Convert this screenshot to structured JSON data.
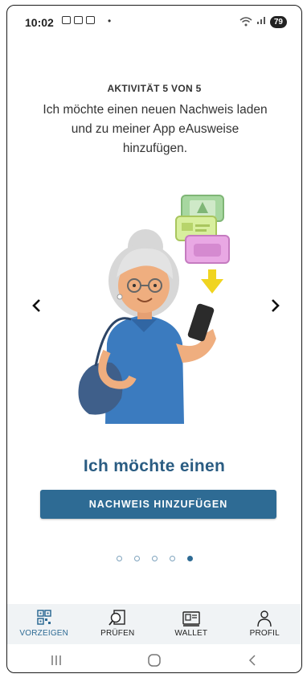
{
  "status_bar": {
    "time": "10:02",
    "separator_dot": "•",
    "battery": "79"
  },
  "onboarding": {
    "activity_label": "AKTIVITÄT 5 VON 5",
    "description": "Ich möchte einen neuen Nachweis laden und zu meiner App eAusweise hinzufügen.",
    "headline": "Ich möchte einen",
    "primary_button": "NACHWEIS HINZUFÜGEN",
    "prev_arrow": "‹",
    "next_arrow": "›",
    "page_count": 5,
    "active_page": 5
  },
  "bottom_nav": {
    "items": [
      {
        "label": "VORZEIGEN",
        "icon": "qr-code-icon",
        "active": true
      },
      {
        "label": "PRÜFEN",
        "icon": "magnifier-document-icon",
        "active": false
      },
      {
        "label": "WALLET",
        "icon": "id-card-icon",
        "active": false
      },
      {
        "label": "PROFIL",
        "icon": "person-icon",
        "active": false
      }
    ]
  },
  "colors": {
    "accent": "#2e6b94",
    "headline": "#2a5c82",
    "nav_background": "#f0f3f5"
  }
}
